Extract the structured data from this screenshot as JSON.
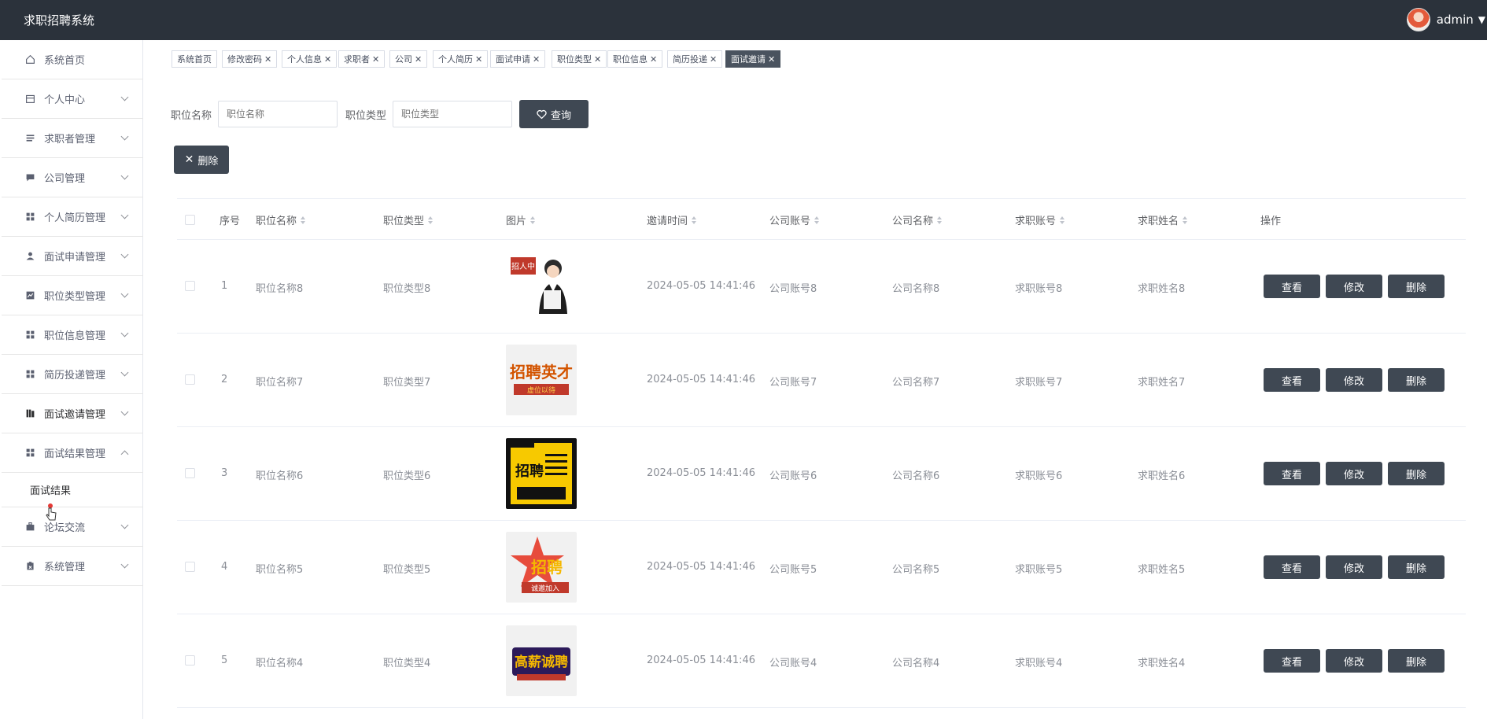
{
  "app": {
    "title": "求职招聘系统",
    "user": "admin"
  },
  "sidebar": {
    "items": [
      {
        "label": "系统首页",
        "icon": "home-icon",
        "expandable": false
      },
      {
        "label": "个人中心",
        "icon": "calendar-icon",
        "expandable": true
      },
      {
        "label": "求职者管理",
        "icon": "list-icon",
        "expandable": true
      },
      {
        "label": "公司管理",
        "icon": "chat-icon",
        "expandable": true
      },
      {
        "label": "个人简历管理",
        "icon": "grid-icon",
        "expandable": true
      },
      {
        "label": "面试申请管理",
        "icon": "user-icon",
        "expandable": true
      },
      {
        "label": "职位类型管理",
        "icon": "chart-icon",
        "expandable": true
      },
      {
        "label": "职位信息管理",
        "icon": "grid-icon",
        "expandable": true
      },
      {
        "label": "简历投递管理",
        "icon": "grid-icon",
        "expandable": true
      },
      {
        "label": "面试邀请管理",
        "icon": "book-icon",
        "expandable": true
      },
      {
        "label": "面试结果管理",
        "icon": "grid-icon",
        "expandable": true,
        "expanded": true
      },
      {
        "label": "论坛交流",
        "icon": "briefcase-icon",
        "expandable": true
      },
      {
        "label": "系统管理",
        "icon": "clipboard-icon",
        "expandable": true
      }
    ],
    "submenu": {
      "label": "面试结果"
    }
  },
  "tabs": [
    {
      "label": "系统首页",
      "closable": false
    },
    {
      "label": "修改密码",
      "closable": true
    },
    {
      "label": "个人信息",
      "closable": true
    },
    {
      "label": "求职者",
      "closable": true
    },
    {
      "label": "公司",
      "closable": true
    },
    {
      "label": "个人简历",
      "closable": true
    },
    {
      "label": "面试申请",
      "closable": true
    },
    {
      "label": "职位类型",
      "closable": true
    },
    {
      "label": "职位信息",
      "closable": true
    },
    {
      "label": "简历投递",
      "closable": true
    },
    {
      "label": "面试邀请",
      "closable": true,
      "active": true
    }
  ],
  "search": {
    "position_name_label": "职位名称",
    "position_name_placeholder": "职位名称",
    "position_type_label": "职位类型",
    "position_type_placeholder": "职位类型",
    "query_button": "查询"
  },
  "toolbar": {
    "delete_button": "删除"
  },
  "table": {
    "headers": {
      "index": "序号",
      "position_name": "职位名称",
      "position_type": "职位类型",
      "image": "图片",
      "invite_time": "邀请时间",
      "company_account": "公司账号",
      "company_name": "公司名称",
      "seeker_account": "求职账号",
      "seeker_name": "求职姓名",
      "actions": "操作"
    },
    "rows": [
      {
        "index": "1",
        "position_name": "职位名称8",
        "position_type": "职位类型8",
        "image_text": "招人中",
        "invite_time": "2024-05-05 14:41:46",
        "company_account": "公司账号8",
        "company_name": "公司名称8",
        "seeker_account": "求职账号8",
        "seeker_name": "求职姓名8"
      },
      {
        "index": "2",
        "position_name": "职位名称7",
        "position_type": "职位类型7",
        "image_text": "招聘英才",
        "invite_time": "2024-05-05 14:41:46",
        "company_account": "公司账号7",
        "company_name": "公司名称7",
        "seeker_account": "求职账号7",
        "seeker_name": "求职姓名7"
      },
      {
        "index": "3",
        "position_name": "职位名称6",
        "position_type": "职位类型6",
        "image_text": "招聘",
        "invite_time": "2024-05-05 14:41:46",
        "company_account": "公司账号6",
        "company_name": "公司名称6",
        "seeker_account": "求职账号6",
        "seeker_name": "求职姓名6"
      },
      {
        "index": "4",
        "position_name": "职位名称5",
        "position_type": "职位类型5",
        "image_text": "招聘",
        "invite_time": "2024-05-05 14:41:46",
        "company_account": "公司账号5",
        "company_name": "公司名称5",
        "seeker_account": "求职账号5",
        "seeker_name": "求职姓名5"
      },
      {
        "index": "5",
        "position_name": "职位名称4",
        "position_type": "职位类型4",
        "image_text": "高薪诚聘",
        "invite_time": "2024-05-05 14:41:46",
        "company_account": "公司账号4",
        "company_name": "公司名称4",
        "seeker_account": "求职账号4",
        "seeker_name": "求职姓名4"
      }
    ],
    "action_labels": {
      "view": "查看",
      "edit": "修改",
      "delete": "删除"
    }
  },
  "colors": {
    "topbar": "#2b323b",
    "dark_button": "#3f4853",
    "active_tab": "#4a535f"
  }
}
